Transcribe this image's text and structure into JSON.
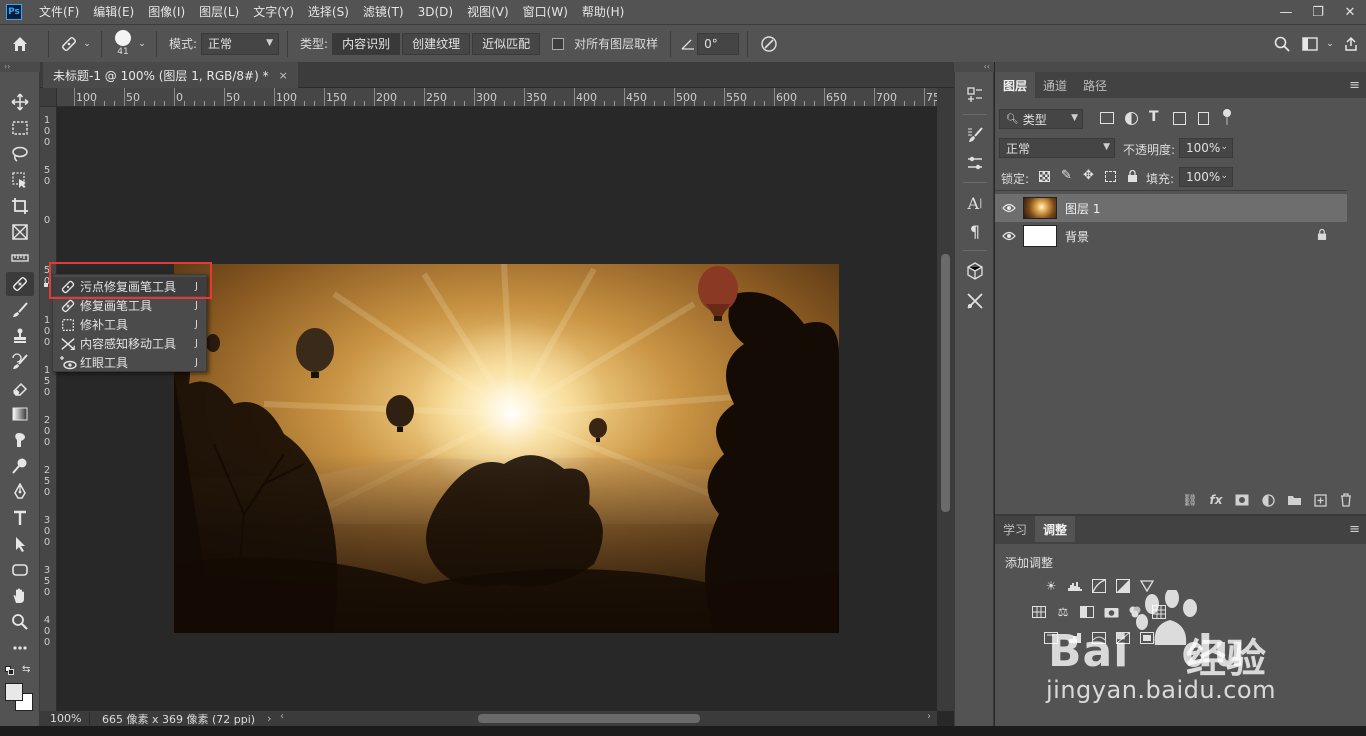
{
  "app": {
    "logo": "Ps"
  },
  "menu": [
    "文件(F)",
    "编辑(E)",
    "图像(I)",
    "图层(L)",
    "文字(Y)",
    "选择(S)",
    "滤镜(T)",
    "3D(D)",
    "视图(V)",
    "窗口(W)",
    "帮助(H)"
  ],
  "options": {
    "brush_size": "41",
    "mode_label": "模式:",
    "mode_value": "正常",
    "type_label": "类型:",
    "type_buttons": [
      "内容识别",
      "创建纹理",
      "近似匹配"
    ],
    "sample_all_label": "对所有图层取样",
    "angle_value": "0°"
  },
  "document": {
    "tab_title": "未标题-1 @ 100% (图层 1, RGB/8#) *",
    "close": "×"
  },
  "ruler": {
    "top_labels": [
      "100",
      "50",
      "0",
      "50",
      "100",
      "150",
      "200",
      "250",
      "300",
      "350",
      "400",
      "450",
      "500",
      "550",
      "600",
      "650",
      "700",
      "75"
    ],
    "left_labels": [
      "1\n0\n0",
      "5\n0",
      "0",
      "5\n0",
      "1\n0\n0",
      "1\n5\n0",
      "2\n0\n0",
      "2\n5\n0",
      "3\n0\n0",
      "3\n5\n0",
      "4\n0\n0"
    ]
  },
  "status": {
    "zoom": "100%",
    "info": "665 像素 x 369 像素 (72 ppi)"
  },
  "flyout": {
    "items": [
      {
        "label": "污点修复画笔工具",
        "key": "J",
        "icon": "spot-healing-brush-icon"
      },
      {
        "label": "修复画笔工具",
        "key": "J",
        "icon": "healing-brush-icon"
      },
      {
        "label": "修补工具",
        "key": "J",
        "icon": "patch-icon"
      },
      {
        "label": "内容感知移动工具",
        "key": "J",
        "icon": "content-aware-move-icon"
      },
      {
        "label": "红眼工具",
        "key": "J",
        "icon": "red-eye-icon"
      }
    ]
  },
  "layers_panel": {
    "tabs": [
      "图层",
      "通道",
      "路径"
    ],
    "filter_value": "类型",
    "blend_mode": "正常",
    "opacity_label": "不透明度:",
    "opacity_value": "100%",
    "lock_label": "锁定:",
    "fill_label": "填充:",
    "fill_value": "100%",
    "layers": [
      {
        "name": "图层 1",
        "selected": true
      },
      {
        "name": "背景",
        "locked": true
      }
    ]
  },
  "adjust_panel": {
    "tabs": [
      "学习",
      "调整"
    ],
    "title": "添加调整"
  },
  "watermark": {
    "brand": "Bai",
    "brand2": "du",
    "jingyan": "经验",
    "url": "jingyan.baidu.com"
  },
  "colors": {
    "accent_red": "#e53935",
    "panel_bg": "#535353",
    "canvas_bg": "#282828"
  }
}
